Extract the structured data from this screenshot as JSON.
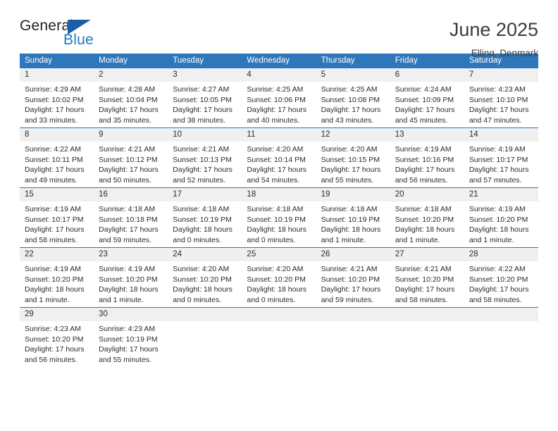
{
  "brand": {
    "name_top": "General",
    "name_bottom": "Blue",
    "accent_color": "#1f7ac0",
    "triangle_color": "#1a5fa8"
  },
  "header": {
    "title": "June 2025",
    "subtitle": "Elling, Denmark"
  },
  "calendar": {
    "header_bg": "#2f77bb",
    "daynum_bg": "#f0f0f0",
    "weekday_headers": [
      "Sunday",
      "Monday",
      "Tuesday",
      "Wednesday",
      "Thursday",
      "Friday",
      "Saturday"
    ],
    "weeks": [
      [
        {
          "day": "1",
          "sunrise": "Sunrise: 4:29 AM",
          "sunset": "Sunset: 10:02 PM",
          "daylight_line1": "Daylight: 17 hours",
          "daylight_line2": "and 33 minutes."
        },
        {
          "day": "2",
          "sunrise": "Sunrise: 4:28 AM",
          "sunset": "Sunset: 10:04 PM",
          "daylight_line1": "Daylight: 17 hours",
          "daylight_line2": "and 35 minutes."
        },
        {
          "day": "3",
          "sunrise": "Sunrise: 4:27 AM",
          "sunset": "Sunset: 10:05 PM",
          "daylight_line1": "Daylight: 17 hours",
          "daylight_line2": "and 38 minutes."
        },
        {
          "day": "4",
          "sunrise": "Sunrise: 4:25 AM",
          "sunset": "Sunset: 10:06 PM",
          "daylight_line1": "Daylight: 17 hours",
          "daylight_line2": "and 40 minutes."
        },
        {
          "day": "5",
          "sunrise": "Sunrise: 4:25 AM",
          "sunset": "Sunset: 10:08 PM",
          "daylight_line1": "Daylight: 17 hours",
          "daylight_line2": "and 43 minutes."
        },
        {
          "day": "6",
          "sunrise": "Sunrise: 4:24 AM",
          "sunset": "Sunset: 10:09 PM",
          "daylight_line1": "Daylight: 17 hours",
          "daylight_line2": "and 45 minutes."
        },
        {
          "day": "7",
          "sunrise": "Sunrise: 4:23 AM",
          "sunset": "Sunset: 10:10 PM",
          "daylight_line1": "Daylight: 17 hours",
          "daylight_line2": "and 47 minutes."
        }
      ],
      [
        {
          "day": "8",
          "sunrise": "Sunrise: 4:22 AM",
          "sunset": "Sunset: 10:11 PM",
          "daylight_line1": "Daylight: 17 hours",
          "daylight_line2": "and 49 minutes."
        },
        {
          "day": "9",
          "sunrise": "Sunrise: 4:21 AM",
          "sunset": "Sunset: 10:12 PM",
          "daylight_line1": "Daylight: 17 hours",
          "daylight_line2": "and 50 minutes."
        },
        {
          "day": "10",
          "sunrise": "Sunrise: 4:21 AM",
          "sunset": "Sunset: 10:13 PM",
          "daylight_line1": "Daylight: 17 hours",
          "daylight_line2": "and 52 minutes."
        },
        {
          "day": "11",
          "sunrise": "Sunrise: 4:20 AM",
          "sunset": "Sunset: 10:14 PM",
          "daylight_line1": "Daylight: 17 hours",
          "daylight_line2": "and 54 minutes."
        },
        {
          "day": "12",
          "sunrise": "Sunrise: 4:20 AM",
          "sunset": "Sunset: 10:15 PM",
          "daylight_line1": "Daylight: 17 hours",
          "daylight_line2": "and 55 minutes."
        },
        {
          "day": "13",
          "sunrise": "Sunrise: 4:19 AM",
          "sunset": "Sunset: 10:16 PM",
          "daylight_line1": "Daylight: 17 hours",
          "daylight_line2": "and 56 minutes."
        },
        {
          "day": "14",
          "sunrise": "Sunrise: 4:19 AM",
          "sunset": "Sunset: 10:17 PM",
          "daylight_line1": "Daylight: 17 hours",
          "daylight_line2": "and 57 minutes."
        }
      ],
      [
        {
          "day": "15",
          "sunrise": "Sunrise: 4:19 AM",
          "sunset": "Sunset: 10:17 PM",
          "daylight_line1": "Daylight: 17 hours",
          "daylight_line2": "and 58 minutes."
        },
        {
          "day": "16",
          "sunrise": "Sunrise: 4:18 AM",
          "sunset": "Sunset: 10:18 PM",
          "daylight_line1": "Daylight: 17 hours",
          "daylight_line2": "and 59 minutes."
        },
        {
          "day": "17",
          "sunrise": "Sunrise: 4:18 AM",
          "sunset": "Sunset: 10:19 PM",
          "daylight_line1": "Daylight: 18 hours",
          "daylight_line2": "and 0 minutes."
        },
        {
          "day": "18",
          "sunrise": "Sunrise: 4:18 AM",
          "sunset": "Sunset: 10:19 PM",
          "daylight_line1": "Daylight: 18 hours",
          "daylight_line2": "and 0 minutes."
        },
        {
          "day": "19",
          "sunrise": "Sunrise: 4:18 AM",
          "sunset": "Sunset: 10:19 PM",
          "daylight_line1": "Daylight: 18 hours",
          "daylight_line2": "and 1 minute."
        },
        {
          "day": "20",
          "sunrise": "Sunrise: 4:18 AM",
          "sunset": "Sunset: 10:20 PM",
          "daylight_line1": "Daylight: 18 hours",
          "daylight_line2": "and 1 minute."
        },
        {
          "day": "21",
          "sunrise": "Sunrise: 4:19 AM",
          "sunset": "Sunset: 10:20 PM",
          "daylight_line1": "Daylight: 18 hours",
          "daylight_line2": "and 1 minute."
        }
      ],
      [
        {
          "day": "22",
          "sunrise": "Sunrise: 4:19 AM",
          "sunset": "Sunset: 10:20 PM",
          "daylight_line1": "Daylight: 18 hours",
          "daylight_line2": "and 1 minute."
        },
        {
          "day": "23",
          "sunrise": "Sunrise: 4:19 AM",
          "sunset": "Sunset: 10:20 PM",
          "daylight_line1": "Daylight: 18 hours",
          "daylight_line2": "and 1 minute."
        },
        {
          "day": "24",
          "sunrise": "Sunrise: 4:20 AM",
          "sunset": "Sunset: 10:20 PM",
          "daylight_line1": "Daylight: 18 hours",
          "daylight_line2": "and 0 minutes."
        },
        {
          "day": "25",
          "sunrise": "Sunrise: 4:20 AM",
          "sunset": "Sunset: 10:20 PM",
          "daylight_line1": "Daylight: 18 hours",
          "daylight_line2": "and 0 minutes."
        },
        {
          "day": "26",
          "sunrise": "Sunrise: 4:21 AM",
          "sunset": "Sunset: 10:20 PM",
          "daylight_line1": "Daylight: 17 hours",
          "daylight_line2": "and 59 minutes."
        },
        {
          "day": "27",
          "sunrise": "Sunrise: 4:21 AM",
          "sunset": "Sunset: 10:20 PM",
          "daylight_line1": "Daylight: 17 hours",
          "daylight_line2": "and 58 minutes."
        },
        {
          "day": "28",
          "sunrise": "Sunrise: 4:22 AM",
          "sunset": "Sunset: 10:20 PM",
          "daylight_line1": "Daylight: 17 hours",
          "daylight_line2": "and 58 minutes."
        }
      ],
      [
        {
          "day": "29",
          "sunrise": "Sunrise: 4:23 AM",
          "sunset": "Sunset: 10:20 PM",
          "daylight_line1": "Daylight: 17 hours",
          "daylight_line2": "and 56 minutes."
        },
        {
          "day": "30",
          "sunrise": "Sunrise: 4:23 AM",
          "sunset": "Sunset: 10:19 PM",
          "daylight_line1": "Daylight: 17 hours",
          "daylight_line2": "and 55 minutes."
        },
        {
          "day": "",
          "sunrise": "",
          "sunset": "",
          "daylight_line1": "",
          "daylight_line2": ""
        },
        {
          "day": "",
          "sunrise": "",
          "sunset": "",
          "daylight_line1": "",
          "daylight_line2": ""
        },
        {
          "day": "",
          "sunrise": "",
          "sunset": "",
          "daylight_line1": "",
          "daylight_line2": ""
        },
        {
          "day": "",
          "sunrise": "",
          "sunset": "",
          "daylight_line1": "",
          "daylight_line2": ""
        },
        {
          "day": "",
          "sunrise": "",
          "sunset": "",
          "daylight_line1": "",
          "daylight_line2": ""
        }
      ]
    ]
  }
}
